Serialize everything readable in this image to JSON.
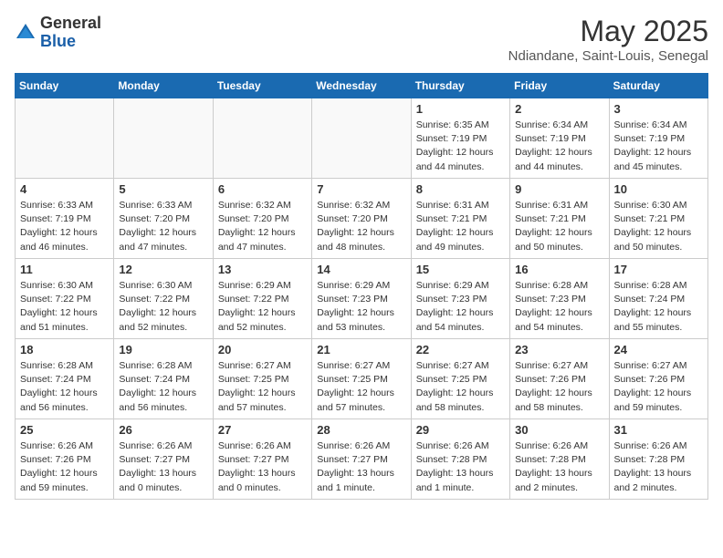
{
  "logo": {
    "general": "General",
    "blue": "Blue"
  },
  "title": "May 2025",
  "subtitle": "Ndiandane, Saint-Louis, Senegal",
  "days_of_week": [
    "Sunday",
    "Monday",
    "Tuesday",
    "Wednesday",
    "Thursday",
    "Friday",
    "Saturday"
  ],
  "weeks": [
    [
      {
        "day": "",
        "info": ""
      },
      {
        "day": "",
        "info": ""
      },
      {
        "day": "",
        "info": ""
      },
      {
        "day": "",
        "info": ""
      },
      {
        "day": "1",
        "info": "Sunrise: 6:35 AM\nSunset: 7:19 PM\nDaylight: 12 hours\nand 44 minutes."
      },
      {
        "day": "2",
        "info": "Sunrise: 6:34 AM\nSunset: 7:19 PM\nDaylight: 12 hours\nand 44 minutes."
      },
      {
        "day": "3",
        "info": "Sunrise: 6:34 AM\nSunset: 7:19 PM\nDaylight: 12 hours\nand 45 minutes."
      }
    ],
    [
      {
        "day": "4",
        "info": "Sunrise: 6:33 AM\nSunset: 7:19 PM\nDaylight: 12 hours\nand 46 minutes."
      },
      {
        "day": "5",
        "info": "Sunrise: 6:33 AM\nSunset: 7:20 PM\nDaylight: 12 hours\nand 47 minutes."
      },
      {
        "day": "6",
        "info": "Sunrise: 6:32 AM\nSunset: 7:20 PM\nDaylight: 12 hours\nand 47 minutes."
      },
      {
        "day": "7",
        "info": "Sunrise: 6:32 AM\nSunset: 7:20 PM\nDaylight: 12 hours\nand 48 minutes."
      },
      {
        "day": "8",
        "info": "Sunrise: 6:31 AM\nSunset: 7:21 PM\nDaylight: 12 hours\nand 49 minutes."
      },
      {
        "day": "9",
        "info": "Sunrise: 6:31 AM\nSunset: 7:21 PM\nDaylight: 12 hours\nand 50 minutes."
      },
      {
        "day": "10",
        "info": "Sunrise: 6:30 AM\nSunset: 7:21 PM\nDaylight: 12 hours\nand 50 minutes."
      }
    ],
    [
      {
        "day": "11",
        "info": "Sunrise: 6:30 AM\nSunset: 7:22 PM\nDaylight: 12 hours\nand 51 minutes."
      },
      {
        "day": "12",
        "info": "Sunrise: 6:30 AM\nSunset: 7:22 PM\nDaylight: 12 hours\nand 52 minutes."
      },
      {
        "day": "13",
        "info": "Sunrise: 6:29 AM\nSunset: 7:22 PM\nDaylight: 12 hours\nand 52 minutes."
      },
      {
        "day": "14",
        "info": "Sunrise: 6:29 AM\nSunset: 7:23 PM\nDaylight: 12 hours\nand 53 minutes."
      },
      {
        "day": "15",
        "info": "Sunrise: 6:29 AM\nSunset: 7:23 PM\nDaylight: 12 hours\nand 54 minutes."
      },
      {
        "day": "16",
        "info": "Sunrise: 6:28 AM\nSunset: 7:23 PM\nDaylight: 12 hours\nand 54 minutes."
      },
      {
        "day": "17",
        "info": "Sunrise: 6:28 AM\nSunset: 7:24 PM\nDaylight: 12 hours\nand 55 minutes."
      }
    ],
    [
      {
        "day": "18",
        "info": "Sunrise: 6:28 AM\nSunset: 7:24 PM\nDaylight: 12 hours\nand 56 minutes."
      },
      {
        "day": "19",
        "info": "Sunrise: 6:28 AM\nSunset: 7:24 PM\nDaylight: 12 hours\nand 56 minutes."
      },
      {
        "day": "20",
        "info": "Sunrise: 6:27 AM\nSunset: 7:25 PM\nDaylight: 12 hours\nand 57 minutes."
      },
      {
        "day": "21",
        "info": "Sunrise: 6:27 AM\nSunset: 7:25 PM\nDaylight: 12 hours\nand 57 minutes."
      },
      {
        "day": "22",
        "info": "Sunrise: 6:27 AM\nSunset: 7:25 PM\nDaylight: 12 hours\nand 58 minutes."
      },
      {
        "day": "23",
        "info": "Sunrise: 6:27 AM\nSunset: 7:26 PM\nDaylight: 12 hours\nand 58 minutes."
      },
      {
        "day": "24",
        "info": "Sunrise: 6:27 AM\nSunset: 7:26 PM\nDaylight: 12 hours\nand 59 minutes."
      }
    ],
    [
      {
        "day": "25",
        "info": "Sunrise: 6:26 AM\nSunset: 7:26 PM\nDaylight: 12 hours\nand 59 minutes."
      },
      {
        "day": "26",
        "info": "Sunrise: 6:26 AM\nSunset: 7:27 PM\nDaylight: 13 hours\nand 0 minutes."
      },
      {
        "day": "27",
        "info": "Sunrise: 6:26 AM\nSunset: 7:27 PM\nDaylight: 13 hours\nand 0 minutes."
      },
      {
        "day": "28",
        "info": "Sunrise: 6:26 AM\nSunset: 7:27 PM\nDaylight: 13 hours\nand 1 minute."
      },
      {
        "day": "29",
        "info": "Sunrise: 6:26 AM\nSunset: 7:28 PM\nDaylight: 13 hours\nand 1 minute."
      },
      {
        "day": "30",
        "info": "Sunrise: 6:26 AM\nSunset: 7:28 PM\nDaylight: 13 hours\nand 2 minutes."
      },
      {
        "day": "31",
        "info": "Sunrise: 6:26 AM\nSunset: 7:28 PM\nDaylight: 13 hours\nand 2 minutes."
      }
    ]
  ]
}
